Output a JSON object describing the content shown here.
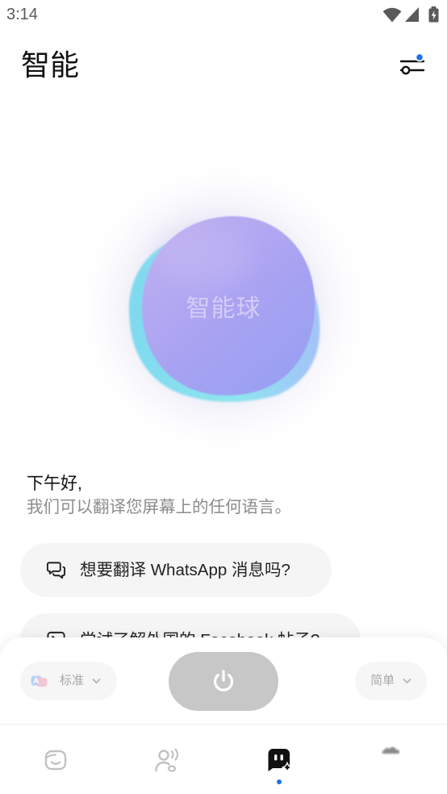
{
  "status_bar": {
    "time": "3:14",
    "icons": [
      "wifi-icon",
      "signal-icon",
      "battery-charging-icon"
    ]
  },
  "header": {
    "title": "智能",
    "settings_icon": "tune-settings-icon"
  },
  "orb": {
    "label": "智能球"
  },
  "greeting": {
    "title": "下午好,",
    "subtitle": "我们可以翻译您屏幕上的任何语言。"
  },
  "suggestions": [
    {
      "icon": "chat-bubbles-icon",
      "text": "想要翻译 WhatsApp 消息吗?"
    },
    {
      "icon": "image-icon",
      "text": "尝试了解外国的 Facebook 帖子?"
    }
  ],
  "controls": {
    "mode": {
      "icon": "translate-icon",
      "label": "标准"
    },
    "power": {
      "icon": "power-icon"
    },
    "style": {
      "label": "简单"
    }
  },
  "bottom_nav": {
    "items": [
      {
        "icon": "home-face-icon",
        "active": false
      },
      {
        "icon": "voice-person-icon",
        "active": false
      },
      {
        "icon": "smart-chat-icon",
        "active": true
      },
      {
        "icon": "profile-cloud-icon",
        "active": false
      }
    ]
  },
  "colors": {
    "accent": "#1a73e8",
    "orb_purple": "#a9a2f2",
    "orb_cyan": "#88e0f0",
    "power_button": "#c7c7c7",
    "chip_background": "#f5f5f5"
  }
}
